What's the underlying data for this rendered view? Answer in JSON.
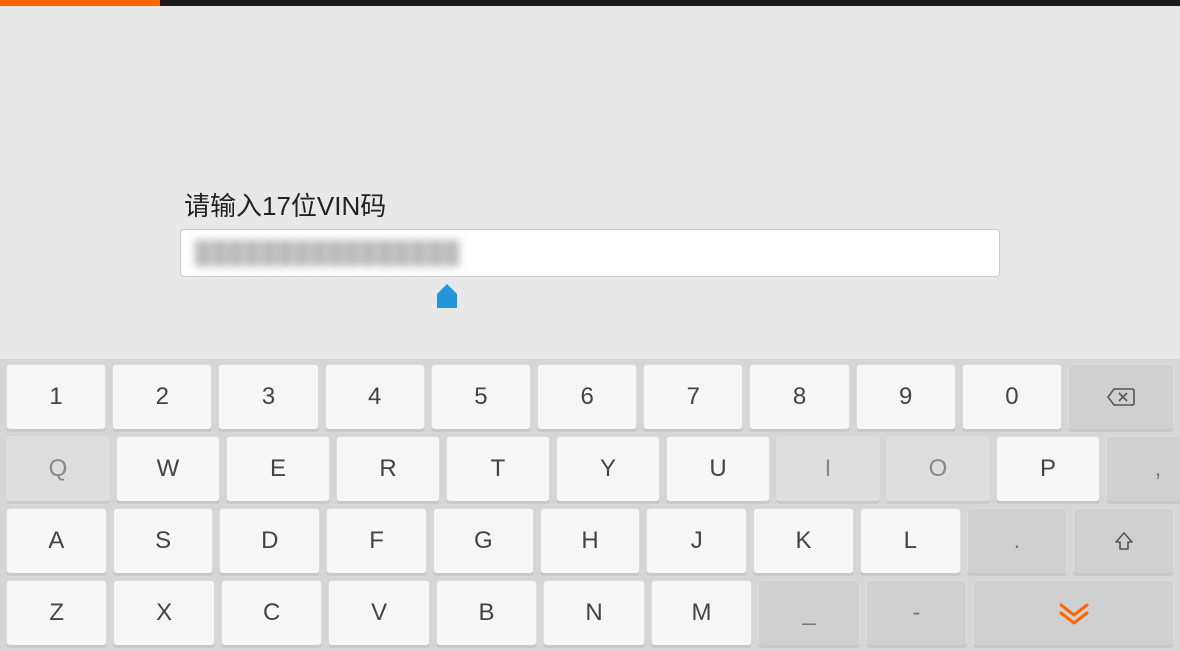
{
  "prompt": {
    "label": "请输入17位VIN码"
  },
  "input": {
    "value": "████████████████"
  },
  "keyboard": {
    "row1": [
      "1",
      "2",
      "3",
      "4",
      "5",
      "6",
      "7",
      "8",
      "9",
      "0"
    ],
    "row2": [
      "Q",
      "W",
      "E",
      "R",
      "T",
      "Y",
      "U",
      "I",
      "O",
      "P",
      ","
    ],
    "row3": [
      "A",
      "S",
      "D",
      "F",
      "G",
      "H",
      "J",
      "K",
      "L",
      "."
    ],
    "row4": [
      "Z",
      "X",
      "C",
      "V",
      "B",
      "N",
      "M",
      "_",
      "-"
    ],
    "backspace": "⌫",
    "shift": "⇧",
    "collapse": "⌄"
  }
}
